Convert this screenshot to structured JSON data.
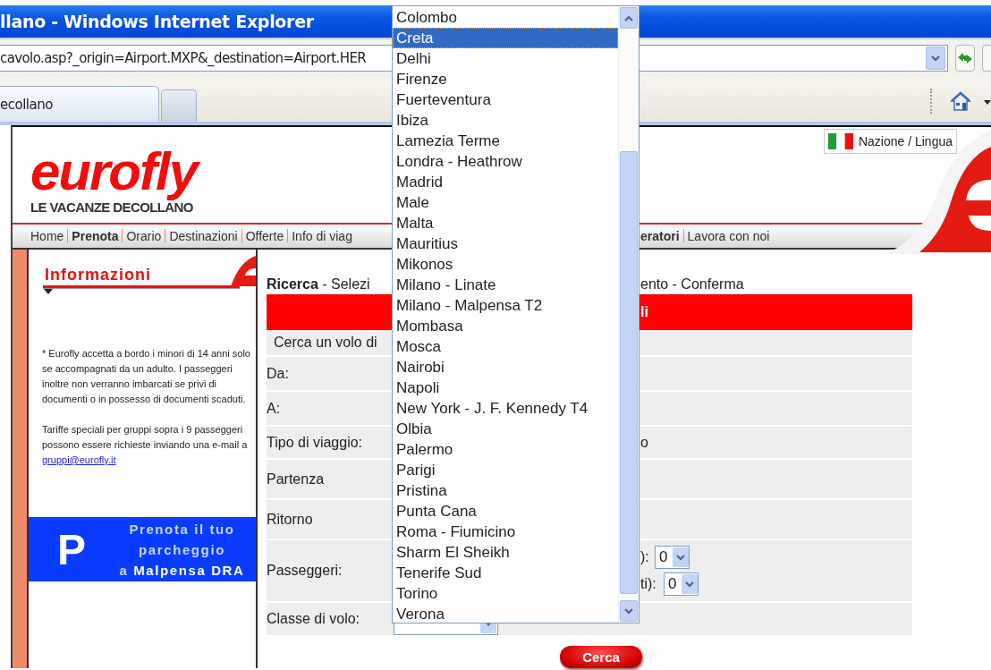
{
  "window": {
    "title": "llano - Windows Internet Explorer"
  },
  "address_bar": {
    "url": "cavolo.asp?_origin=Airport.MXP&_destination=Airport.HER"
  },
  "tabs": [
    {
      "label": "ecollano",
      "selected": true
    }
  ],
  "site": {
    "logo": "eurofly",
    "tagline": "LE VACANZE DECOLLANO",
    "language_button": "Nazione / Lingua",
    "nav_left": [
      {
        "label": "Home",
        "emphasized": false
      },
      {
        "label": "Prenota",
        "emphasized": true
      },
      {
        "label": "Orario",
        "emphasized": false
      },
      {
        "label": "Destinazioni",
        "emphasized": false
      },
      {
        "label": "Offerte",
        "emphasized": false
      },
      {
        "label": "Info di viag",
        "emphasized": false
      }
    ],
    "nav_right": [
      {
        "label": "eratori",
        "emphasized": true
      },
      {
        "label": "Lavora con noi",
        "emphasized": false
      }
    ]
  },
  "sidebar": {
    "title": "Informazioni",
    "notice": "* Eurofly accetta a bordo i minori di 14 anni solo se accompagnati da un adulto. I passeggeri inoltre non verranno imbarcati se privi di documenti o in possesso di documenti scaduti.",
    "groups_text": "Tariffe speciali per gruppi sopra i 9 passeggeri possono essere richieste inviando una e-mail a",
    "email": "gruppi@eurofly.it",
    "banner": {
      "letter": "P",
      "lines": [
        "Prenota il tuo",
        "parcheggio",
        "a **Malpensa DRA**"
      ]
    }
  },
  "main": {
    "breadcrumb_left": "**Ricerca** - Selezi",
    "breadcrumb_right": "ento - Conferma",
    "header_fragment": "li",
    "rows": [
      {
        "kind": "caption",
        "label": "Cerca un volo di"
      },
      {
        "kind": "field",
        "label": "Da:"
      },
      {
        "kind": "field",
        "label": "A:"
      },
      {
        "kind": "field",
        "label": "Tipo di viaggio:",
        "fragment": "o"
      },
      {
        "kind": "field",
        "label": "Partenza"
      },
      {
        "kind": "field",
        "label": "Ritorno"
      },
      {
        "kind": "passengers",
        "label": "Passeggeri:",
        "counts": [
          {
            "fragment": "):",
            "value": "0"
          },
          {
            "fragment": "ti):",
            "value": "0"
          }
        ]
      },
      {
        "kind": "select",
        "label": "Classe di volo:"
      }
    ],
    "search_button": "Cerca"
  },
  "dropdown": {
    "items": [
      {
        "label": "Colombo",
        "selected": false
      },
      {
        "label": "Creta",
        "selected": true
      },
      {
        "label": "Delhi",
        "selected": false
      },
      {
        "label": "Firenze",
        "selected": false
      },
      {
        "label": "Fuerteventura",
        "selected": false
      },
      {
        "label": "Ibiza",
        "selected": false
      },
      {
        "label": "Lamezia Terme",
        "selected": false
      },
      {
        "label": "Londra - Heathrow",
        "selected": false
      },
      {
        "label": "Madrid",
        "selected": false
      },
      {
        "label": "Male",
        "selected": false
      },
      {
        "label": "Malta",
        "selected": false
      },
      {
        "label": "Mauritius",
        "selected": false
      },
      {
        "label": "Mikonos",
        "selected": false
      },
      {
        "label": "Milano - Linate",
        "selected": false
      },
      {
        "label": "Milano - Malpensa T2",
        "selected": false
      },
      {
        "label": "Mombasa",
        "selected": false
      },
      {
        "label": "Mosca",
        "selected": false
      },
      {
        "label": "Nairobi",
        "selected": false
      },
      {
        "label": "Napoli",
        "selected": false
      },
      {
        "label": "New York - J. F. Kennedy T4",
        "selected": false
      },
      {
        "label": "Olbia",
        "selected": false
      },
      {
        "label": "Palermo",
        "selected": false
      },
      {
        "label": "Parigi",
        "selected": false
      },
      {
        "label": "Pristina",
        "selected": false
      },
      {
        "label": "Punta Cana",
        "selected": false
      },
      {
        "label": "Roma - Fiumicino",
        "selected": false
      },
      {
        "label": "Sharm El Sheikh",
        "selected": false
      },
      {
        "label": "Tenerife Sud",
        "selected": false
      },
      {
        "label": "Torino",
        "selected": false
      },
      {
        "label": "Verona",
        "selected": false
      }
    ]
  }
}
